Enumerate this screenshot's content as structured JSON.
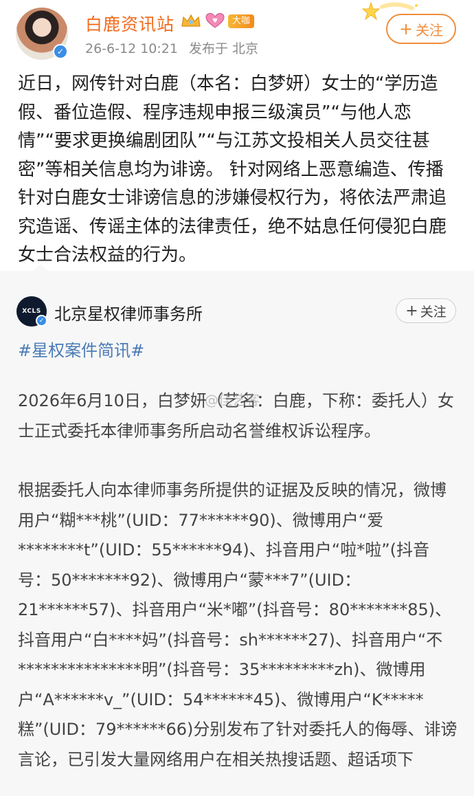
{
  "post": {
    "author_name": "白鹿资讯站",
    "level_badge": "大咖",
    "date": "26-6-12 10:21",
    "source": "发布于 北京",
    "follow_label": "关注",
    "body": "近日，网传针对白鹿（本名：白梦妍）女士的“学历造假、番位造假、程序违规申报三级演员”“与他人恋情”“要求更换编剧团队”“与江苏文投相关人员交往甚密”等相关信息均为诽谤。 针对网络上恶意编造、传播针对白鹿女士诽谤信息的涉嫌侵权行为，将依法严肃追究造谣、传谣主体的法律责任，绝不姑息任何侵犯白鹿女士合法权益的行为。"
  },
  "repost": {
    "avatar_text": "XCLS",
    "author_name": "北京星权律师事务所",
    "follow_label": "关注",
    "topic": "#星权案件简讯#",
    "paragraph1": "2026年6月10日，白梦妍（艺名：白鹿，下称：委托人）女士正式委托本律师事务所启动名誉维权诉讼程序。",
    "paragraph2": "根据委托人向本律师事务所提供的证据及反映的情况，微博用户“糊***桃”(UID：77******90)、微博用户“爱********t”(UID：55******94)、抖音用户“啦*啦”(抖音号：50*******92)、微博用户“蒙***7”(UID：21******57)、抖音用户“米*嘟”(抖音号：80*******85)、抖音用户“白****妈”(抖音号：sh******27)、抖音用户“不***************明”(抖音号：35*********zh)、微博用户“A******v_”(UID：54******45)、微博用户“K*****糕”(UID：79******66)分别发布了针对委托人的侮辱、诽谤言论，已引发大量网络用户在相关热搜话题、超话项下",
    "watermark": "@佳艺客"
  },
  "icons": {
    "verified": "verified-check-icon",
    "crown": "crown-badge-icon",
    "heart": "heart-badge-icon",
    "plus": "plus-icon"
  },
  "colors": {
    "author_name": "#f26b1d",
    "follow_accent": "#f08d3a",
    "topic": "#4a7bb5",
    "repost_bg": "#f7f7f7"
  }
}
